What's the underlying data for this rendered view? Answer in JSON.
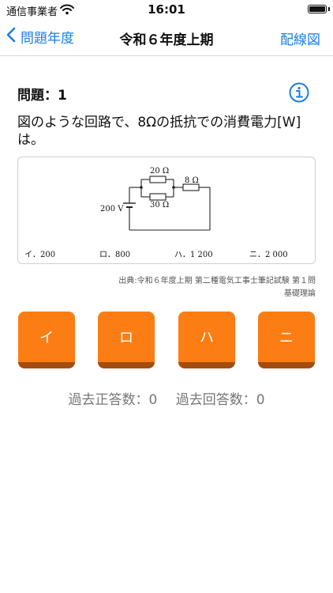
{
  "status": {
    "carrier": "通信事業者",
    "time": "16:01"
  },
  "nav": {
    "back_label": "問題年度",
    "title": "令和６年度上期",
    "right_label": "配線図"
  },
  "question": {
    "number_label": "問題：1",
    "text": "図のような回路で、8Ωの抵抗での消費電力[W]は。"
  },
  "figure": {
    "r_top": "20 Ω",
    "r_bottom": "30 Ω",
    "r_series": "8 Ω",
    "voltage": "200 V",
    "options": [
      "イ．200",
      "ロ．800",
      "ハ．1 200",
      "ニ．2 000"
    ]
  },
  "source": {
    "line1": "出典:令和６年度上期 第二種電気工事士筆記試験 第１問",
    "line2": "基礎理論"
  },
  "answers": [
    "イ",
    "ロ",
    "ハ",
    "ニ"
  ],
  "stats": {
    "correct": "過去正答数：0",
    "attempts": "過去回答数：0"
  },
  "colors": {
    "accent": "#1a7ee6",
    "answer_button": "#fc7d14",
    "answer_shadow": "#a34e0f"
  }
}
